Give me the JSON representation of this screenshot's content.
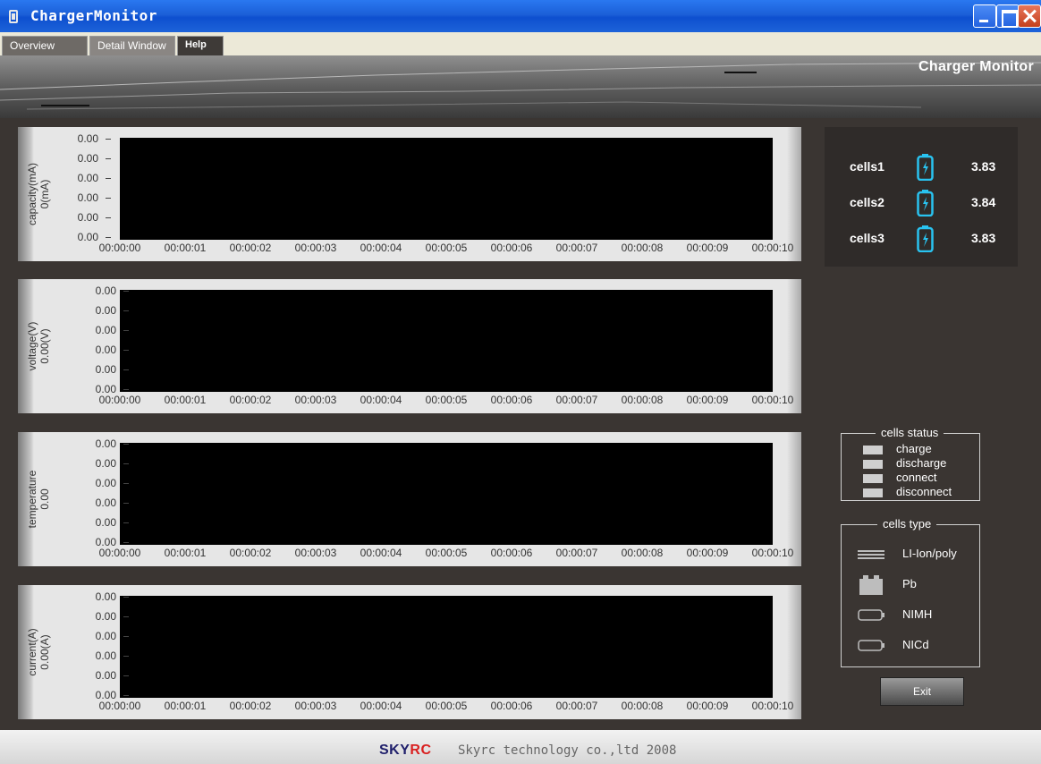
{
  "window": {
    "title": "ChargerMonitor"
  },
  "tabs": [
    {
      "label": "Overview"
    },
    {
      "label": "Detail Window"
    },
    {
      "label": "Help"
    }
  ],
  "banner": {
    "title": "Charger Monitor"
  },
  "charts": [
    {
      "ylabel": "capacity(mA)\n0(mA)",
      "yticks": [
        "0.00",
        "0.00",
        "0.00",
        "0.00",
        "0.00",
        "0.00"
      ]
    },
    {
      "ylabel": "voltage(V)\n0.00(V)",
      "yticks": [
        "0.00",
        "0.00",
        "0.00",
        "0.00",
        "0.00",
        "0.00"
      ]
    },
    {
      "ylabel": "temperature\n0.00",
      "yticks": [
        "0.00",
        "0.00",
        "0.00",
        "0.00",
        "0.00",
        "0.00"
      ]
    },
    {
      "ylabel": "current(A)\n0.00(A)",
      "yticks": [
        "0.00",
        "0.00",
        "0.00",
        "0.00",
        "0.00",
        "0.00"
      ]
    }
  ],
  "xticks": [
    "00:00:00",
    "00:00:01",
    "00:00:02",
    "00:00:03",
    "00:00:04",
    "00:00:05",
    "00:00:06",
    "00:00:07",
    "00:00:08",
    "00:00:09",
    "00:00:10"
  ],
  "cells": [
    {
      "name": "cells1",
      "value": "3.83"
    },
    {
      "name": "cells2",
      "value": "3.84"
    },
    {
      "name": "cells3",
      "value": "3.83"
    }
  ],
  "cells_status": {
    "title": "cells status",
    "items": [
      "charge",
      "discharge",
      "connect",
      "disconnect"
    ]
  },
  "cells_type": {
    "title": "cells type",
    "items": [
      "LI-Ion/poly",
      "Pb",
      "NIMH",
      "NICd"
    ]
  },
  "exit_label": "Exit",
  "footer": {
    "logo_text": "SKY",
    "logo_accent": "RC",
    "text": "Skyrc technology co.,ltd 2008"
  },
  "colors": {
    "titlebar": "#1b5fd8",
    "background": "#3a3532",
    "battery": "#29c3f0"
  }
}
